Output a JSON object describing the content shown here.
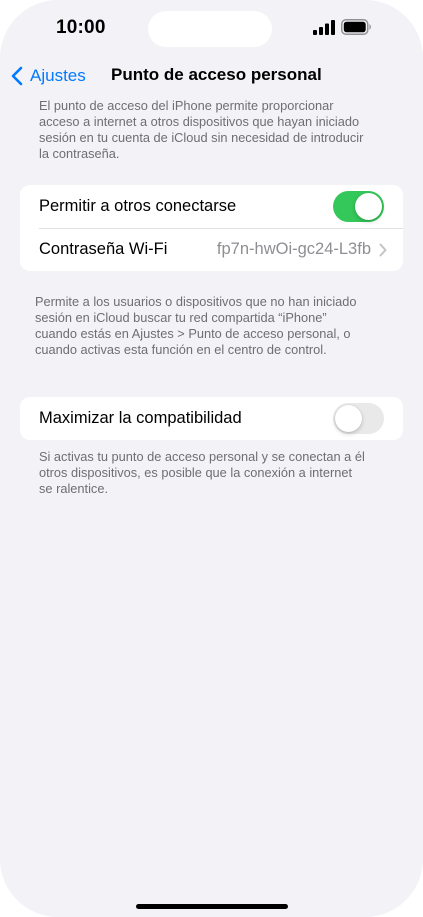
{
  "status_bar": {
    "time": "10:00",
    "icons": [
      "cellular-signal-icon",
      "battery-icon"
    ]
  },
  "nav": {
    "back_label": "Ajustes",
    "title": "Punto de acceso personal"
  },
  "intro_text": [
    "El punto de acceso del iPhone permite proporcionar",
    "acceso a internet a otros dispositivos que hayan iniciado",
    "sesión en tu cuenta de iCloud sin necesidad de introducir",
    "la contraseña."
  ],
  "allow_group": {
    "allow_others": {
      "label": "Permitir a otros conectarse",
      "enabled": true
    },
    "wifi_password": {
      "label": "Contraseña Wi-Fi",
      "value": "fp7n-hwOi-gc24-L3fb"
    }
  },
  "allow_footer": [
    "Permite a los usuarios o dispositivos que no han iniciado",
    "sesión en iCloud buscar tu red compartida “iPhone”",
    "cuando estás en Ajustes > Punto de acceso personal, o",
    "cuando activas esta función en el centro de control."
  ],
  "compat_group": {
    "maximize_compat": {
      "label": "Maximizar la compatibilidad",
      "enabled": false
    }
  },
  "compat_footer": [
    "Si activas tu punto de acceso personal y se conectan a él",
    "otros dispositivos, es posible que la conexión a internet",
    "se ralentice."
  ],
  "colors": {
    "accent": "#007aff",
    "toggle_on": "#34c759",
    "toggle_off": "#e9e9ea",
    "background": "#f2f2f7"
  }
}
